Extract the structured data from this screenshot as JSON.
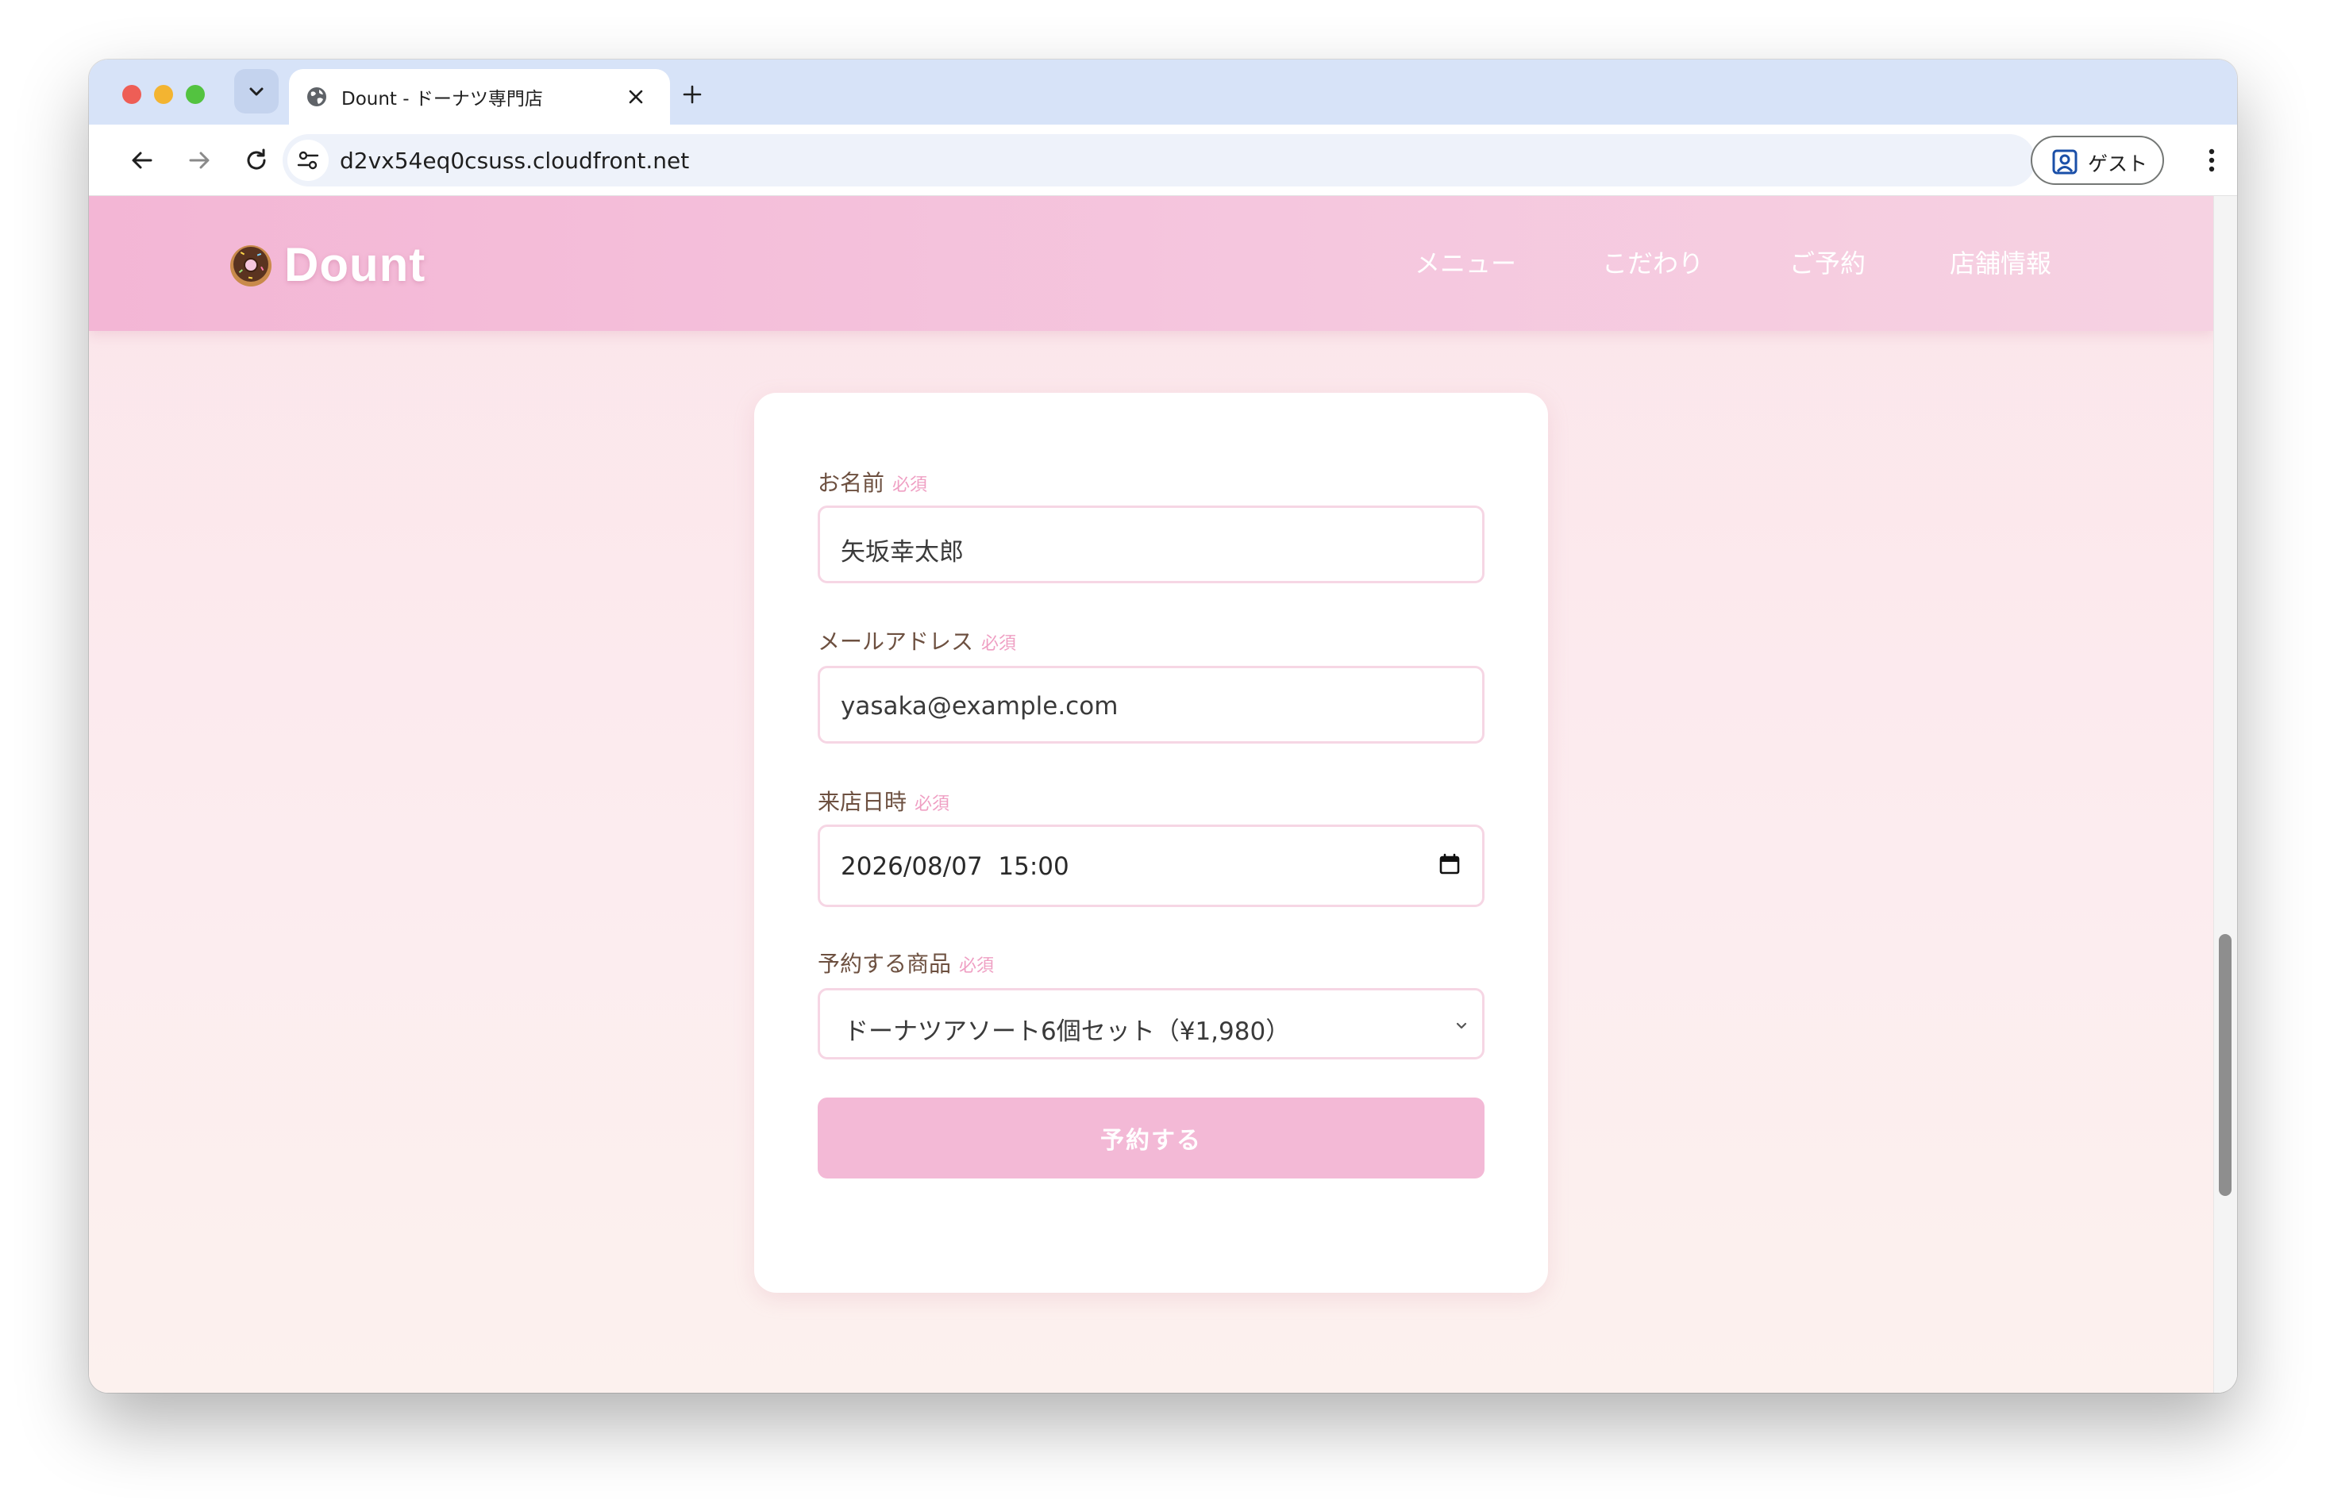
{
  "browser": {
    "tab_title": "Dount - ドーナツ専門店",
    "url": "d2vx54eq0csuss.cloudfront.net",
    "profile_label": "ゲスト"
  },
  "site": {
    "logo_text": "Dount",
    "nav": [
      "メニュー",
      "こだわり",
      "ご予約",
      "店舗情報"
    ]
  },
  "form": {
    "required_badge": "必須",
    "name": {
      "label": "お名前",
      "value": "矢坂幸太郎"
    },
    "email": {
      "label": "メールアドレス",
      "value": "yasaka@example.com"
    },
    "datetime": {
      "label": "来店日時",
      "value": "2026/08/07  15:00"
    },
    "product": {
      "label": "予約する商品",
      "selected": "ドーナツアソート6個セット（¥1,980）"
    },
    "submit_label": "予約する"
  },
  "colors": {
    "header_pink": "#f3b6d5",
    "button_pink": "#f3b9d6",
    "label_brown": "#6d5040",
    "required_pink": "#ef9fc3"
  }
}
